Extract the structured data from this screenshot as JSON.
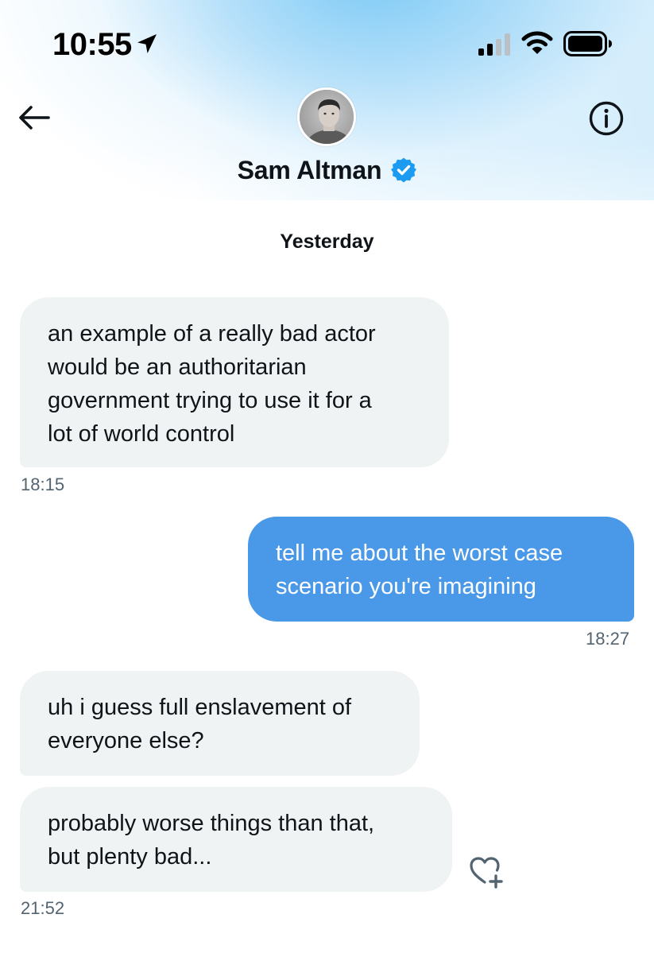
{
  "status_bar": {
    "time": "10:55",
    "icons": [
      "location-arrow-icon",
      "cellular-signal-icon",
      "wifi-icon",
      "battery-icon"
    ]
  },
  "header": {
    "contact_name": "Sam Altman",
    "verified": true,
    "back_icon": "back-arrow-icon",
    "info_icon": "info-icon"
  },
  "conversation": {
    "date_separator": "Yesterday",
    "messages": [
      {
        "direction": "incoming",
        "text": "an example of a really bad actor\nwould be an authoritarian\ngovernment trying to use it for a\nlot of world control"
      },
      {
        "direction": "outgoing",
        "text": "tell me about the worst case\nscenario you're imagining"
      },
      {
        "direction": "incoming",
        "text": "uh i guess full enslavement of\neveryone else?"
      },
      {
        "direction": "incoming",
        "text": "probably worse things than that,\nbut plenty bad..."
      }
    ],
    "timestamps": [
      "18:15",
      "18:27",
      "21:52"
    ]
  },
  "colors": {
    "outgoing_bubble": "#4a99e9",
    "incoming_bubble": "#eff3f4",
    "verified_badge": "#1d9bf0",
    "timestamp": "#536471"
  }
}
